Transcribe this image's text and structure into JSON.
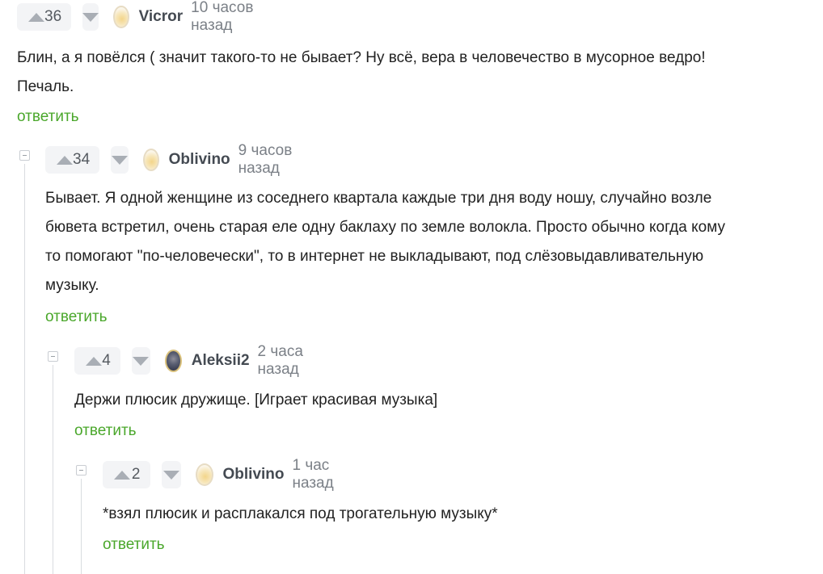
{
  "comments": [
    {
      "rating": "36",
      "author": "Vicror",
      "time": "10 часов назад",
      "text": "Блин, а я повёлся ( значит такого-то не бывает? Ну всё, вера в человечество в мусорное ведро!\nПечаль.",
      "reply_label": "ответить",
      "avatar": "default-avatar-icon"
    },
    {
      "rating": "34",
      "author": "Oblivino",
      "time": "9 часов назад",
      "text": "Бывает. Я одной женщине из соседнего квартала каждые три дня воду ношу, случайно возле\nбювета встретил, очень старая еле одну баклаху по земле волокла. Просто обычно когда кому\nто помогают \"по-человечески\", то в интернет не выкладывают, под слёзовыдавливательную\nмузыку.",
      "reply_label": "ответить",
      "avatar": "default-avatar-icon"
    },
    {
      "rating": "4",
      "author": "Aleksii2",
      "time": "2 часа назад",
      "text": "Держи плюсик дружище. [Играет красивая музыка]",
      "reply_label": "ответить",
      "avatar": "user-photo-avatar"
    },
    {
      "rating": "2",
      "author": "Oblivino",
      "time": "1 час назад",
      "text": "*взял плюсик и расплакался под трогательную музыку*",
      "reply_label": "ответить",
      "avatar": "default-avatar-icon"
    }
  ],
  "colors": {
    "reply_link": "#4aa72b",
    "vote_bg": "#f3f4f6",
    "muted_text": "#7b8087"
  }
}
